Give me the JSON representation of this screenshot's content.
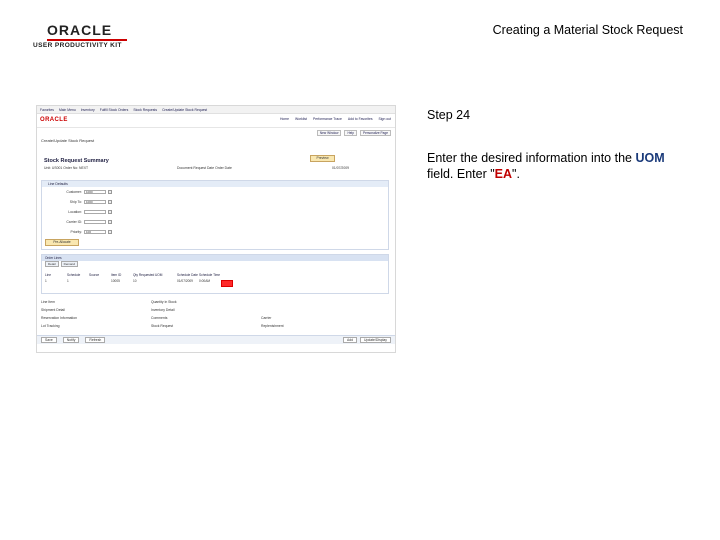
{
  "slide": {
    "title": "Creating a Material Stock Request",
    "logo_brand": "ORACLE",
    "logo_sub": "USER PRODUCTIVITY KIT"
  },
  "step": {
    "title": "Step 24",
    "text_before": "Enter the desired information into the ",
    "field_name": "UOM",
    "text_middle": " field. Enter \"",
    "value": "EA",
    "text_after": "\"."
  },
  "colors": {
    "field_highlight": "#1a3a7a",
    "value_highlight": "#c00000",
    "uom_marker": "#ff2a2a"
  },
  "screenshot": {
    "nav_top": [
      "Favorites",
      "Main Menu",
      "Inventory",
      "Fulfill Stock Orders",
      "Stock Requests",
      "Create/Update Stock Request"
    ],
    "brand": "ORACLE",
    "nav_links": [
      "Home",
      "Worklist",
      "Performance Trace",
      "Add to Favorites",
      "Sign out"
    ],
    "toolbar": [
      "New Window",
      "Help",
      "Personalize Page"
    ],
    "breadcrumb": "Create/Update Stock Request",
    "section_title": "Stock Request Summary",
    "preview_button": "Preview",
    "status_left": "Unit: US001   Order No: NEXT",
    "status_mid": "Document Request Date  Order Date",
    "status_right": "01/07/2009",
    "line_details_title": "Line Defaults",
    "form_rows": [
      {
        "label": "Customer:",
        "value": "1000"
      },
      {
        "label": "Ship To:",
        "value": "1000"
      },
      {
        "label": "Location:",
        "value": ""
      },
      {
        "label": "Carrier ID:",
        "value": ""
      },
      {
        "label": "Priority:",
        "value": "100"
      }
    ],
    "summary_button": "Pre-Allocate",
    "grid_title": "Order Lines",
    "grid_tabs": [
      "Detail",
      "Demand"
    ],
    "grid_columns": [
      "Line",
      "Schedule",
      "Source",
      "Item ID",
      "Qty Requested",
      "UOM",
      "Schedule Date",
      "Schedule Time"
    ],
    "grid_row": [
      "1",
      "1",
      "",
      "10005",
      "10",
      "",
      "01/07/2009",
      "0:00AM"
    ],
    "bottom_rows": [
      [
        "Line Item",
        "Quantity in Stock",
        ""
      ],
      [
        "Shipment Detail",
        "Inventory Detail",
        ""
      ],
      [
        "Reservation Information",
        "Comments",
        "Carrier"
      ],
      [
        "Lot Tracking",
        "Stock Request",
        "Replenishment"
      ]
    ],
    "footer_buttons": [
      "Save",
      "Notify",
      "Refresh"
    ],
    "footer_right": [
      "Add",
      "Update/Display"
    ]
  }
}
